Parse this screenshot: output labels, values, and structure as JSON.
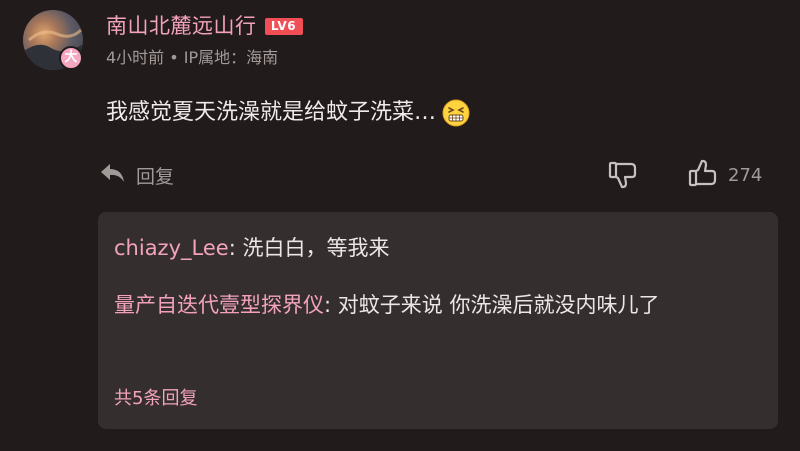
{
  "comment": {
    "username": "南山北麓远山行",
    "level_badge": "LV6",
    "avatar_badge": "大",
    "meta": "4小时前 • IP属地：海南",
    "text": "我感觉夏天洗澡就是给蚊子洗菜…",
    "emoji_icon": "grimacing-face-icon",
    "reply_label": "回复",
    "like_count": "274"
  },
  "replies": [
    {
      "user": "chiazy_Lee",
      "sep": ": ",
      "text": "洗白白，等我来"
    },
    {
      "user": "量产自迭代壹型探界仪",
      "sep": ": ",
      "text": "对蚊子来说 你洗澡后就没内味儿了"
    }
  ],
  "more_replies": "共5条回复",
  "colors": {
    "background": "#211b1b",
    "username": "#f3a2bd",
    "level_badge": "#f24e55",
    "muted_text": "#a29a98",
    "reply_box": "#352e2e"
  }
}
